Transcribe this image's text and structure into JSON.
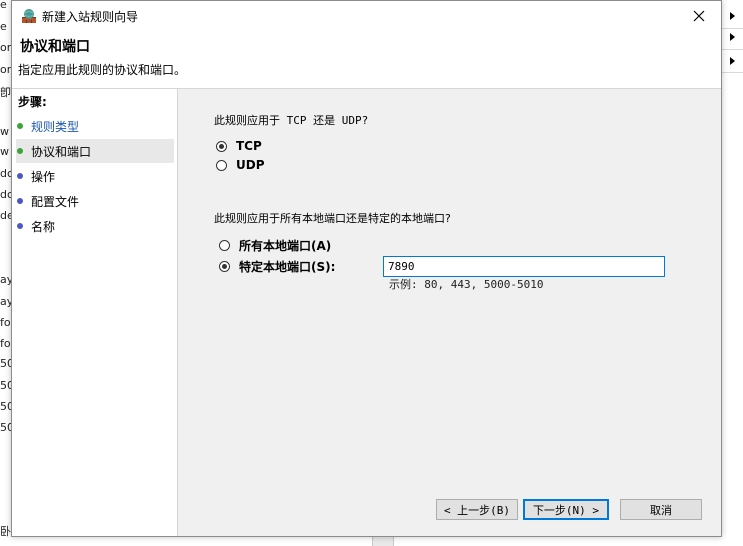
{
  "background_fragments": {
    "left": [
      "e",
      "e",
      "or",
      "or",
      "卽",
      "w",
      "w",
      "dc",
      "dc",
      "de",
      "ay",
      "ay",
      "fo",
      "fo",
      "50",
      "50",
      "50",
      "50",
      "卧"
    ],
    "right_arrows": 3
  },
  "dialog": {
    "title": "新建入站规则向导",
    "header_title": "协议和端口",
    "header_desc": "指定应用此规则的协议和端口。"
  },
  "steps": {
    "label": "步骤:",
    "items": [
      {
        "label": "规则类型",
        "state": "done"
      },
      {
        "label": "协议和端口",
        "state": "current"
      },
      {
        "label": "操作",
        "state": "pending"
      },
      {
        "label": "配置文件",
        "state": "pending"
      },
      {
        "label": "名称",
        "state": "pending"
      }
    ]
  },
  "protocol": {
    "question": "此规则应用于 TCP 还是 UDP?",
    "options": [
      {
        "label": "TCP",
        "selected": true
      },
      {
        "label": "UDP",
        "selected": false
      }
    ]
  },
  "ports": {
    "question": "此规则应用于所有本地端口还是特定的本地端口?",
    "options": [
      {
        "label": "所有本地端口(A)",
        "selected": false
      },
      {
        "label": "特定本地端口(S):",
        "selected": true
      }
    ],
    "value": "7890",
    "example": "示例: 80, 443, 5000-5010"
  },
  "buttons": {
    "back": "< 上一步(B)",
    "next": "下一步(N) >",
    "cancel": "取消"
  },
  "colors": {
    "accent": "#0078d7",
    "done_dot": "#3aa33a",
    "pending_dot": "#4b58c4",
    "done_link": "#1a57b0"
  }
}
